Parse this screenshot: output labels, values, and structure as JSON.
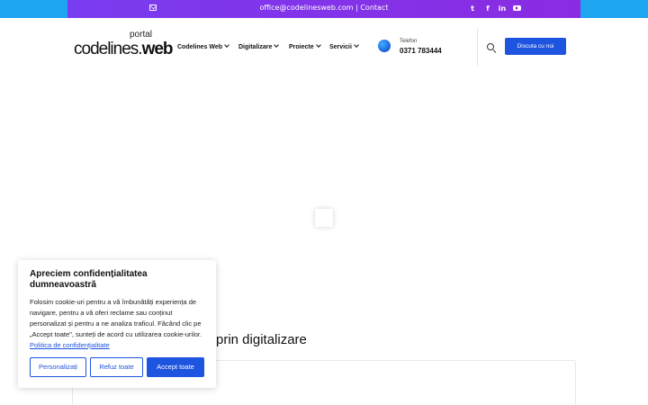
{
  "topbar": {
    "contact_text": "office@codelinesweb.com | Contact",
    "mail_icon": "mail-icon",
    "social": {
      "twitter": "t",
      "facebook": "f",
      "linkedin": "in"
    }
  },
  "header": {
    "logo_portal": "portal",
    "logo_light": "codelines.",
    "logo_bold": "web",
    "nav": [
      {
        "label": "Codelines Web"
      },
      {
        "label": "Digitalizare"
      },
      {
        "label": "Proiecte"
      },
      {
        "label": "Servicii"
      }
    ],
    "phone_label": "Telefon",
    "phone_number": "0371 783444",
    "cta_label": "Discuta cu noi"
  },
  "main": {
    "section_heading": "prin digitalizare"
  },
  "cookie": {
    "title": "Apreciem confidențialitatea dumneavoastră",
    "text": "Folosim cookie-uri pentru a vă îmbunătăți experiența de navigare, pentru a vă oferi reclame sau conținut personalizat și pentru a ne analiza traficul. Făcând clic pe „Accept toate\", sunteți de acord cu utilizarea cookie-urilor.",
    "policy_link": "Politica de confidențialitate",
    "btn_customize": "Personalizați",
    "btn_reject": "Refuz toate",
    "btn_accept": "Accept toate"
  },
  "colors": {
    "brand_blue": "#1d54e0",
    "topbar_purple": "#8a2be2",
    "topbar_cyan": "#1da5f0"
  }
}
